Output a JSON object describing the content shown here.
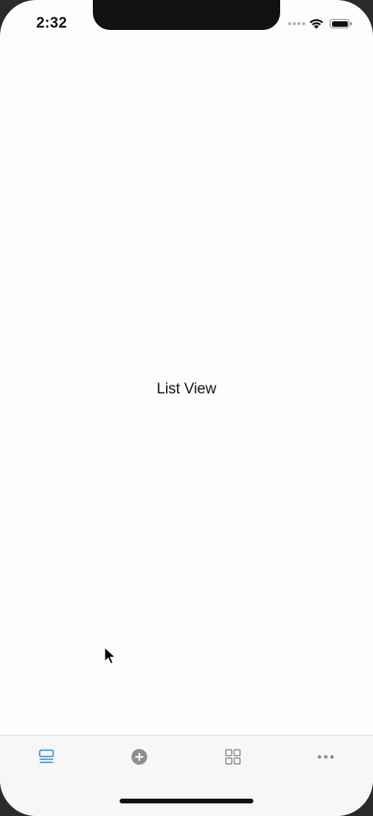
{
  "status_bar": {
    "time": "2:32"
  },
  "main": {
    "label": "List View"
  },
  "tab_bar": {
    "items": [
      {
        "icon": "list-icon",
        "active": true
      },
      {
        "icon": "add-circle-icon",
        "active": false
      },
      {
        "icon": "grid-icon",
        "active": false
      },
      {
        "icon": "more-icon",
        "active": false
      }
    ]
  },
  "colors": {
    "active_tab": "#2f86d6",
    "inactive_tab": "#8e8e93",
    "background": "#fdfdfd",
    "tab_bar_background": "#f7f7f7"
  }
}
